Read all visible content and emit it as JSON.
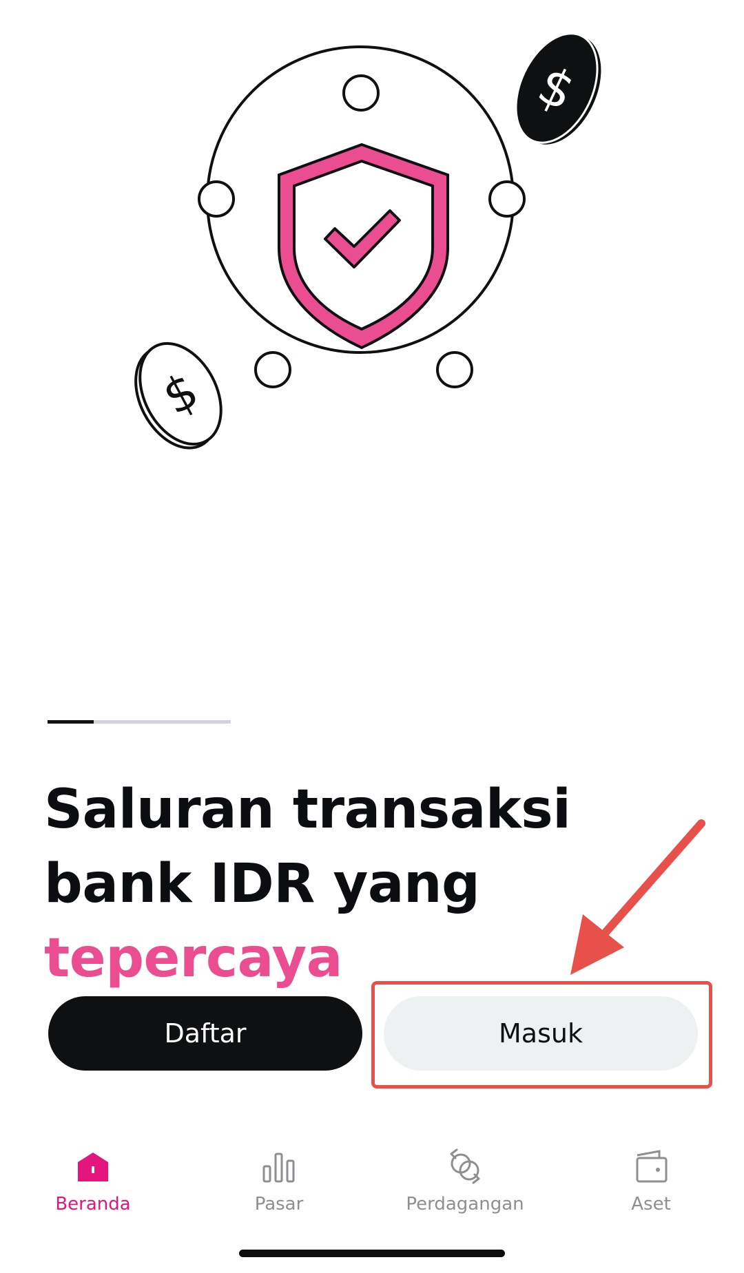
{
  "onboarding": {
    "headline_part1": "Saluran transaksi bank IDR yang ",
    "headline_highlight": "tepercaya",
    "progress_fraction": 0.25
  },
  "actions": {
    "register_label": "Daftar",
    "login_label": "Masuk"
  },
  "nav": {
    "items": [
      {
        "label": "Beranda",
        "icon": "home-icon",
        "active": true
      },
      {
        "label": "Pasar",
        "icon": "bar-chart-icon",
        "active": false
      },
      {
        "label": "Perdagangan",
        "icon": "exchange-icon",
        "active": false
      },
      {
        "label": "Aset",
        "icon": "wallet-icon",
        "active": false
      }
    ]
  },
  "colors": {
    "accent": "#e4157d",
    "highlight_text": "#ea4d90",
    "primary_button": "#0f1012",
    "secondary_button": "#eef1f2",
    "annotation": "#e8504a"
  }
}
